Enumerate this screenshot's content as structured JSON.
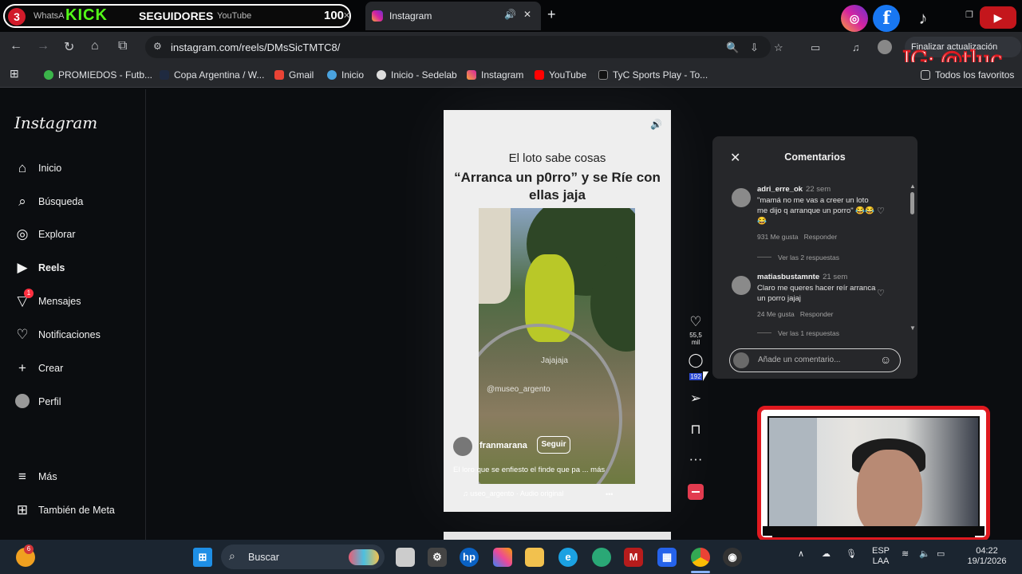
{
  "browser": {
    "stream_overlay": {
      "tab_count": "3",
      "ghost_title_left": "WhatsA",
      "brand": "KICK",
      "label": "SEGUIDORES",
      "ghost_title_right": "YouTube",
      "count": "100"
    },
    "active_tab": {
      "title": "Instagram"
    },
    "url": "instagram.com/reels/DMsSicTMTC8/",
    "update_button": "Finalizar actualización",
    "watermark": "IG: @tluc",
    "bookmarks": [
      "PROMIEDOS - Futb...",
      "Copa Argentina / W...",
      "Gmail",
      "Inicio",
      "Inicio - Sedelab",
      "Instagram",
      "YouTube",
      "TyC Sports Play - To..."
    ],
    "all_bookmarks": "Todos los favoritos"
  },
  "sidebar": {
    "logo": "Instagram",
    "items": [
      {
        "label": "Inicio",
        "icon": "home-icon"
      },
      {
        "label": "Búsqueda",
        "icon": "search-icon"
      },
      {
        "label": "Explorar",
        "icon": "compass-icon"
      },
      {
        "label": "Reels",
        "icon": "reels-icon"
      },
      {
        "label": "Mensajes",
        "icon": "messenger-icon",
        "badge": "1"
      },
      {
        "label": "Notificaciones",
        "icon": "heart-icon"
      },
      {
        "label": "Crear",
        "icon": "plus-icon"
      },
      {
        "label": "Perfil",
        "icon": "avatar-icon"
      }
    ],
    "more": "Más",
    "meta": "También de Meta"
  },
  "reel": {
    "top_text": "El loto sabe cosas",
    "caption": "“Arranca un p0rro” y se Ríe con ellas jaja",
    "video_text": "Jajajaja",
    "video_watermark": "@museo_argento",
    "username": "franmarana",
    "follow": "Seguir",
    "description": "El loro que se enfiesto el finde que pa ...",
    "more": "más",
    "audio": "useo_argento · Audio original",
    "likes": "55,5 mil",
    "comments_count": "192"
  },
  "comments": {
    "title": "Comentarios",
    "items": [
      {
        "user": "adri_erre_ok",
        "time": "22 sem",
        "text": "\"mamá no me vas a creer un loto me dijo q arranque un porro\" 😂😂😂",
        "likes": "931 Me gusta",
        "reply": "Responder",
        "view_replies": "Ver las 2 respuestas"
      },
      {
        "user": "matiasbustamnte",
        "time": "21 sem",
        "text": "Claro me queres hacer reír arranca un porro jajaj",
        "likes": "24 Me gusta",
        "reply": "Responder",
        "view_replies": "Ver las 1 respuestas"
      }
    ],
    "placeholder": "Añade un comentario..."
  },
  "taskbar": {
    "search": "Buscar",
    "weather_badge": "6",
    "lang": "ESP",
    "layout": "LAA",
    "time": "04:22",
    "date": "19/1/2026"
  },
  "colors": {
    "accent_red": "#e0191f",
    "kick_green": "#53fc18",
    "ig_badge": "#ff3040"
  }
}
